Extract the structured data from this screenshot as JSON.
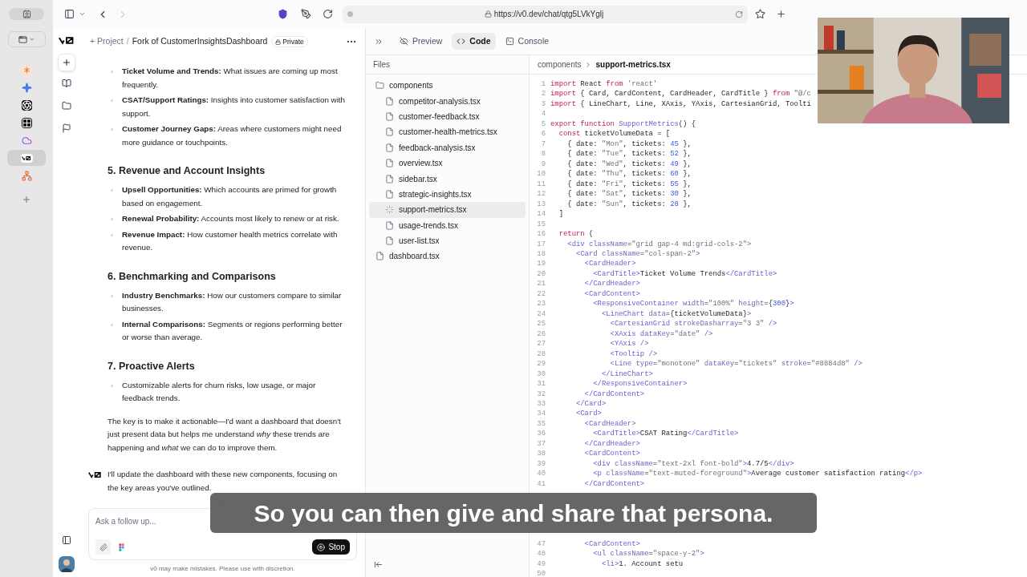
{
  "browser_tabs": [
    {
      "kind": "asterisk",
      "selected": false
    },
    {
      "kind": "sparkle",
      "selected": false
    },
    {
      "kind": "knot",
      "selected": false
    },
    {
      "kind": "grid",
      "selected": false
    },
    {
      "kind": "cloud",
      "selected": false
    },
    {
      "kind": "logo",
      "selected": true
    },
    {
      "kind": "nodes",
      "selected": false
    }
  ],
  "address_bar": {
    "url": "https://v0.dev/chat/qtg5LVkYglj"
  },
  "project": {
    "prefix": "+ Project",
    "separator": "/",
    "name": "Fork of CustomerInsightsDashboard",
    "badge": "Private"
  },
  "chat": {
    "sections": [
      {
        "items": [
          "**Ticket Volume and Trends:** What issues are coming up most frequently.",
          "**CSAT/Support Ratings:** Insights into customer satisfaction with support.",
          "**Customer Journey Gaps:** Areas where customers might need more guidance or touchpoints."
        ]
      },
      {
        "heading": "5. Revenue and Account Insights",
        "items": [
          "**Upsell Opportunities:** Which accounts are primed for growth based on engagement.",
          "**Renewal Probability:** Accounts most likely to renew or at risk.",
          "**Revenue Impact:** How customer health metrics correlate with revenue."
        ]
      },
      {
        "heading": "6. Benchmarking and Comparisons",
        "items": [
          "**Industry Benchmarks:** How our customers compare to similar businesses.",
          "**Internal Comparisons:** Segments or regions performing better or worse than average."
        ]
      },
      {
        "heading": "7. Proactive Alerts",
        "items": [
          "Customizable alerts for churn risks, low usage, or major feedback trends."
        ]
      }
    ],
    "closing": "The key is to make it actionable—I'd want a dashboard that doesn't just present data but helps me understand *why* these trends are happening and *what* we can do to improve them.",
    "reply": "I'll update the dashboard with these new components, focusing on the key areas you've outlined."
  },
  "composer": {
    "placeholder": "Ask a follow up...",
    "stop_label": "Stop",
    "disclaimer": "v0 may make mistakes. Please use with discretion."
  },
  "view_tabs": [
    {
      "kind": "preview",
      "label": "Preview",
      "selected": false
    },
    {
      "kind": "code",
      "label": "Code",
      "selected": true
    },
    {
      "kind": "console",
      "label": "Console",
      "selected": false
    }
  ],
  "files_title": "Files",
  "breadcrumb": [
    "components",
    "support-metrics.tsx"
  ],
  "file_tree": [
    {
      "name": "components",
      "kind": "folder",
      "selected": false,
      "children": [
        {
          "name": "competitor-analysis.tsx",
          "kind": "file",
          "selected": false
        },
        {
          "name": "customer-feedback.tsx",
          "kind": "file",
          "selected": false
        },
        {
          "name": "customer-health-metrics.tsx",
          "kind": "file",
          "selected": false
        },
        {
          "name": "feedback-analysis.tsx",
          "kind": "file",
          "selected": false
        },
        {
          "name": "overview.tsx",
          "kind": "file",
          "selected": false
        },
        {
          "name": "sidebar.tsx",
          "kind": "file",
          "selected": false
        },
        {
          "name": "strategic-insights.tsx",
          "kind": "file",
          "selected": false
        },
        {
          "name": "support-metrics.tsx",
          "kind": "loading",
          "selected": true
        },
        {
          "name": "usage-trends.tsx",
          "kind": "file",
          "selected": false
        },
        {
          "name": "user-list.tsx",
          "kind": "file",
          "selected": false
        }
      ]
    },
    {
      "name": "dashboard.tsx",
      "kind": "file",
      "selected": false
    }
  ],
  "code": [
    {
      "n": "1",
      "seg": [
        {
          "kind": "kw",
          "text": "import "
        },
        {
          "kind": "plain",
          "text": "React "
        },
        {
          "kind": "kw",
          "text": "from "
        },
        {
          "kind": "str",
          "text": "'react'"
        }
      ]
    },
    {
      "n": "2",
      "seg": [
        {
          "kind": "kw",
          "text": "import "
        },
        {
          "kind": "plain",
          "text": "{ Card, CardContent, CardHeader, CardTitle } "
        },
        {
          "kind": "kw",
          "text": "from "
        },
        {
          "kind": "str",
          "text": "\"@/c"
        }
      ]
    },
    {
      "n": "3",
      "seg": [
        {
          "kind": "kw",
          "text": "import "
        },
        {
          "kind": "plain",
          "text": "{ LineChart, Line, XAxis, YAxis, CartesianGrid, Toolti"
        }
      ]
    },
    {
      "n": "4"
    },
    {
      "n": "5",
      "seg": [
        {
          "kind": "kw",
          "text": "export function "
        },
        {
          "kind": "tag",
          "text": "SupportMetrics"
        },
        {
          "kind": "plain",
          "text": "() {"
        }
      ]
    },
    {
      "n": "6",
      "seg": [
        {
          "kind": "kw",
          "text": "  const "
        },
        {
          "kind": "plain",
          "text": "ticketVolumeData = ["
        }
      ]
    },
    {
      "n": "7",
      "seg": [
        {
          "kind": "plain",
          "text": "    { date: "
        },
        {
          "kind": "str",
          "text": "\"Mon\""
        },
        {
          "kind": "plain",
          "text": ", tickets: "
        },
        {
          "kind": "num",
          "text": "45"
        },
        {
          "kind": "plain",
          "text": " },"
        }
      ]
    },
    {
      "n": "8",
      "seg": [
        {
          "kind": "plain",
          "text": "    { date: "
        },
        {
          "kind": "str",
          "text": "\"Tue\""
        },
        {
          "kind": "plain",
          "text": ", tickets: "
        },
        {
          "kind": "num",
          "text": "52"
        },
        {
          "kind": "plain",
          "text": " },"
        }
      ]
    },
    {
      "n": "9",
      "seg": [
        {
          "kind": "plain",
          "text": "    { date: "
        },
        {
          "kind": "str",
          "text": "\"Wed\""
        },
        {
          "kind": "plain",
          "text": ", tickets: "
        },
        {
          "kind": "num",
          "text": "49"
        },
        {
          "kind": "plain",
          "text": " },"
        }
      ]
    },
    {
      "n": "10",
      "seg": [
        {
          "kind": "plain",
          "text": "    { date: "
        },
        {
          "kind": "str",
          "text": "\"Thu\""
        },
        {
          "kind": "plain",
          "text": ", tickets: "
        },
        {
          "kind": "num",
          "text": "60"
        },
        {
          "kind": "plain",
          "text": " },"
        }
      ]
    },
    {
      "n": "11",
      "seg": [
        {
          "kind": "plain",
          "text": "    { date: "
        },
        {
          "kind": "str",
          "text": "\"Fri\""
        },
        {
          "kind": "plain",
          "text": ", tickets: "
        },
        {
          "kind": "num",
          "text": "55"
        },
        {
          "kind": "plain",
          "text": " },"
        }
      ]
    },
    {
      "n": "12",
      "seg": [
        {
          "kind": "plain",
          "text": "    { date: "
        },
        {
          "kind": "str",
          "text": "\"Sat\""
        },
        {
          "kind": "plain",
          "text": ", tickets: "
        },
        {
          "kind": "num",
          "text": "30"
        },
        {
          "kind": "plain",
          "text": " },"
        }
      ]
    },
    {
      "n": "13",
      "seg": [
        {
          "kind": "plain",
          "text": "    { date: "
        },
        {
          "kind": "str",
          "text": "\"Sun\""
        },
        {
          "kind": "plain",
          "text": ", tickets: "
        },
        {
          "kind": "num",
          "text": "28"
        },
        {
          "kind": "plain",
          "text": " },"
        }
      ]
    },
    {
      "n": "14",
      "seg": [
        {
          "kind": "plain",
          "text": "  ]"
        }
      ]
    },
    {
      "n": "15"
    },
    {
      "n": "16",
      "seg": [
        {
          "kind": "kw",
          "text": "  return "
        },
        {
          "kind": "plain",
          "text": "("
        }
      ]
    },
    {
      "n": "17",
      "seg": [
        {
          "kind": "tag",
          "text": "    <div "
        },
        {
          "kind": "attr",
          "text": "className"
        },
        {
          "kind": "plain",
          "text": "="
        },
        {
          "kind": "str",
          "text": "\"grid gap-4 md:grid-cols-2\""
        },
        {
          "kind": "tag",
          "text": ">"
        }
      ]
    },
    {
      "n": "18",
      "seg": [
        {
          "kind": "tag",
          "text": "      <Card "
        },
        {
          "kind": "attr",
          "text": "className"
        },
        {
          "kind": "plain",
          "text": "="
        },
        {
          "kind": "str",
          "text": "\"col-span-2\""
        },
        {
          "kind": "tag",
          "text": ">"
        }
      ]
    },
    {
      "n": "19",
      "seg": [
        {
          "kind": "tag",
          "text": "        <CardHeader>"
        }
      ]
    },
    {
      "n": "20",
      "seg": [
        {
          "kind": "tag",
          "text": "          <CardTitle>"
        },
        {
          "kind": "plain",
          "text": "Ticket Volume Trends"
        },
        {
          "kind": "tag",
          "text": "</CardTitle>"
        }
      ]
    },
    {
      "n": "21",
      "seg": [
        {
          "kind": "tag",
          "text": "        </CardHeader>"
        }
      ]
    },
    {
      "n": "22",
      "seg": [
        {
          "kind": "tag",
          "text": "        <CardContent>"
        }
      ]
    },
    {
      "n": "23",
      "seg": [
        {
          "kind": "tag",
          "text": "          <ResponsiveContainer "
        },
        {
          "kind": "attr",
          "text": "width"
        },
        {
          "kind": "plain",
          "text": "="
        },
        {
          "kind": "str",
          "text": "\"100%\" "
        },
        {
          "kind": "attr",
          "text": "height"
        },
        {
          "kind": "plain",
          "text": "={"
        },
        {
          "kind": "num",
          "text": "300"
        },
        {
          "kind": "plain",
          "text": "}"
        },
        {
          "kind": "tag",
          "text": ">"
        }
      ]
    },
    {
      "n": "24",
      "seg": [
        {
          "kind": "tag",
          "text": "            <LineChart "
        },
        {
          "kind": "attr",
          "text": "data"
        },
        {
          "kind": "plain",
          "text": "={ticketVolumeData}"
        },
        {
          "kind": "tag",
          "text": ">"
        }
      ]
    },
    {
      "n": "25",
      "seg": [
        {
          "kind": "tag",
          "text": "              <CartesianGrid "
        },
        {
          "kind": "attr",
          "text": "strokeDasharray"
        },
        {
          "kind": "plain",
          "text": "="
        },
        {
          "kind": "str",
          "text": "\"3 3\" "
        },
        {
          "kind": "tag",
          "text": "/>"
        }
      ]
    },
    {
      "n": "26",
      "seg": [
        {
          "kind": "tag",
          "text": "              <XAxis "
        },
        {
          "kind": "attr",
          "text": "dataKey"
        },
        {
          "kind": "plain",
          "text": "="
        },
        {
          "kind": "str",
          "text": "\"date\" "
        },
        {
          "kind": "tag",
          "text": "/>"
        }
      ]
    },
    {
      "n": "27",
      "seg": [
        {
          "kind": "tag",
          "text": "              <YAxis />"
        }
      ]
    },
    {
      "n": "28",
      "seg": [
        {
          "kind": "tag",
          "text": "              <Tooltip />"
        }
      ]
    },
    {
      "n": "29",
      "seg": [
        {
          "kind": "tag",
          "text": "              <Line "
        },
        {
          "kind": "attr",
          "text": "type"
        },
        {
          "kind": "plain",
          "text": "="
        },
        {
          "kind": "str",
          "text": "\"monotone\" "
        },
        {
          "kind": "attr",
          "text": "dataKey"
        },
        {
          "kind": "plain",
          "text": "="
        },
        {
          "kind": "str",
          "text": "\"tickets\" "
        },
        {
          "kind": "attr",
          "text": "stroke"
        },
        {
          "kind": "plain",
          "text": "="
        },
        {
          "kind": "str",
          "text": "\"#8884d8\" "
        },
        {
          "kind": "tag",
          "text": "/>"
        }
      ]
    },
    {
      "n": "30",
      "seg": [
        {
          "kind": "tag",
          "text": "            </LineChart>"
        }
      ]
    },
    {
      "n": "31",
      "seg": [
        {
          "kind": "tag",
          "text": "          </ResponsiveContainer>"
        }
      ]
    },
    {
      "n": "32",
      "seg": [
        {
          "kind": "tag",
          "text": "        </CardContent>"
        }
      ]
    },
    {
      "n": "33",
      "seg": [
        {
          "kind": "tag",
          "text": "      </Card>"
        }
      ]
    },
    {
      "n": "34",
      "seg": [
        {
          "kind": "tag",
          "text": "      <Card>"
        }
      ]
    },
    {
      "n": "35",
      "seg": [
        {
          "kind": "tag",
          "text": "        <CardHeader>"
        }
      ]
    },
    {
      "n": "36",
      "seg": [
        {
          "kind": "tag",
          "text": "          <CardTitle>"
        },
        {
          "kind": "plain",
          "text": "CSAT Rating"
        },
        {
          "kind": "tag",
          "text": "</CardTitle>"
        }
      ]
    },
    {
      "n": "37",
      "seg": [
        {
          "kind": "tag",
          "text": "        </CardHeader>"
        }
      ]
    },
    {
      "n": "38",
      "seg": [
        {
          "kind": "tag",
          "text": "        <CardContent>"
        }
      ]
    },
    {
      "n": "39",
      "seg": [
        {
          "kind": "tag",
          "text": "          <div "
        },
        {
          "kind": "attr",
          "text": "className"
        },
        {
          "kind": "plain",
          "text": "="
        },
        {
          "kind": "str",
          "text": "\"text-2xl font-bold\""
        },
        {
          "kind": "tag",
          "text": ">"
        },
        {
          "kind": "plain",
          "text": "4.7/5"
        },
        {
          "kind": "tag",
          "text": "</div>"
        }
      ]
    },
    {
      "n": "40",
      "seg": [
        {
          "kind": "tag",
          "text": "          <p "
        },
        {
          "kind": "attr",
          "text": "className"
        },
        {
          "kind": "plain",
          "text": "="
        },
        {
          "kind": "str",
          "text": "\"text-muted-foreground\""
        },
        {
          "kind": "tag",
          "text": ">"
        },
        {
          "kind": "plain",
          "text": "Average customer satisfaction rating"
        },
        {
          "kind": "tag",
          "text": "</p>"
        }
      ]
    },
    {
      "n": "41",
      "seg": [
        {
          "kind": "tag",
          "text": "        </CardContent>"
        }
      ]
    },
    {
      "n": "47",
      "seg": [
        {
          "kind": "tag",
          "text": "        <CardContent>"
        }
      ]
    },
    {
      "n": "48",
      "seg": [
        {
          "kind": "tag",
          "text": "          <ul "
        },
        {
          "kind": "attr",
          "text": "className"
        },
        {
          "kind": "plain",
          "text": "="
        },
        {
          "kind": "str",
          "text": "\"space-y-2\""
        },
        {
          "kind": "tag",
          "text": ">"
        }
      ]
    },
    {
      "n": "49",
      "seg": [
        {
          "kind": "tag",
          "text": "            <li>"
        },
        {
          "kind": "plain",
          "text": "1. Account setu"
        }
      ]
    },
    {
      "n": "50"
    }
  ],
  "webcam": {
    "kind": "picture"
  },
  "subtitle": "So you can then give and share that persona."
}
